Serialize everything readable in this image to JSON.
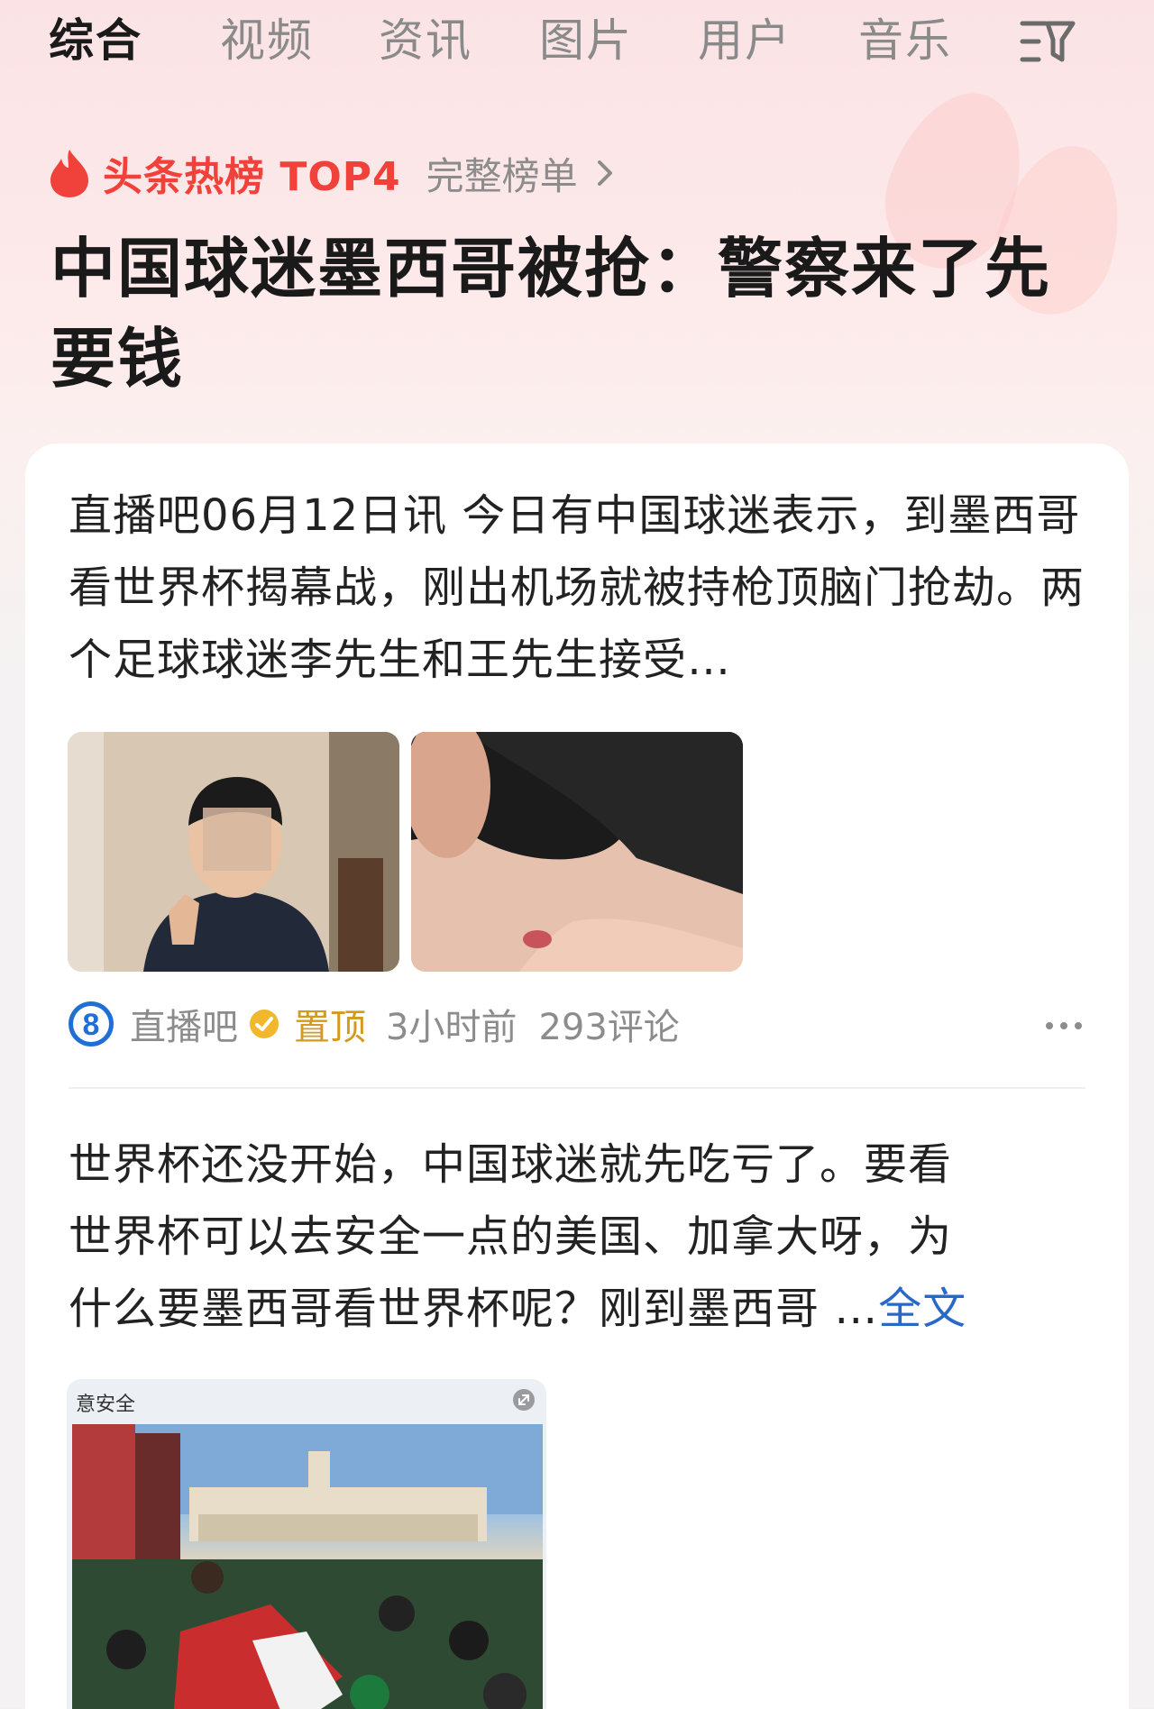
{
  "tabs": {
    "items": [
      {
        "label": "综合",
        "active": true
      },
      {
        "label": "视频",
        "active": false
      },
      {
        "label": "资讯",
        "active": false
      },
      {
        "label": "图片",
        "active": false
      },
      {
        "label": "用户",
        "active": false
      },
      {
        "label": "音乐",
        "active": false
      }
    ],
    "filter_icon": "filter-icon"
  },
  "hot_list": {
    "badge": "头条热榜 TOP4",
    "link": "完整榜单",
    "accent_color": "#f0413a"
  },
  "headline": "中国球迷墨西哥被抢：警察来了先要钱",
  "post1": {
    "text": "直播吧06月12日讯 今日有中国球迷表示，到墨西哥看世界杯揭幕战，刚出机场就被持枪顶脑门抢劫。两个足球球迷李先生和王先生接受…",
    "source": "直播吧",
    "pinned": "置顶",
    "time": "3小时前",
    "comments": "293评论"
  },
  "post2": {
    "line1": "世界杯还没开始，中国球迷就先吃亏了。要看",
    "line2": "世界杯可以去安全一点的美国、加拿大呀，为",
    "line3": "什么要墨西哥看世界杯呢？刚到墨西哥",
    "ellipsis": " …",
    "full_link": "全文",
    "image_label": "意安全"
  },
  "colors": {
    "link_blue": "#2869c7",
    "pinned_gold": "#d39a1e"
  }
}
